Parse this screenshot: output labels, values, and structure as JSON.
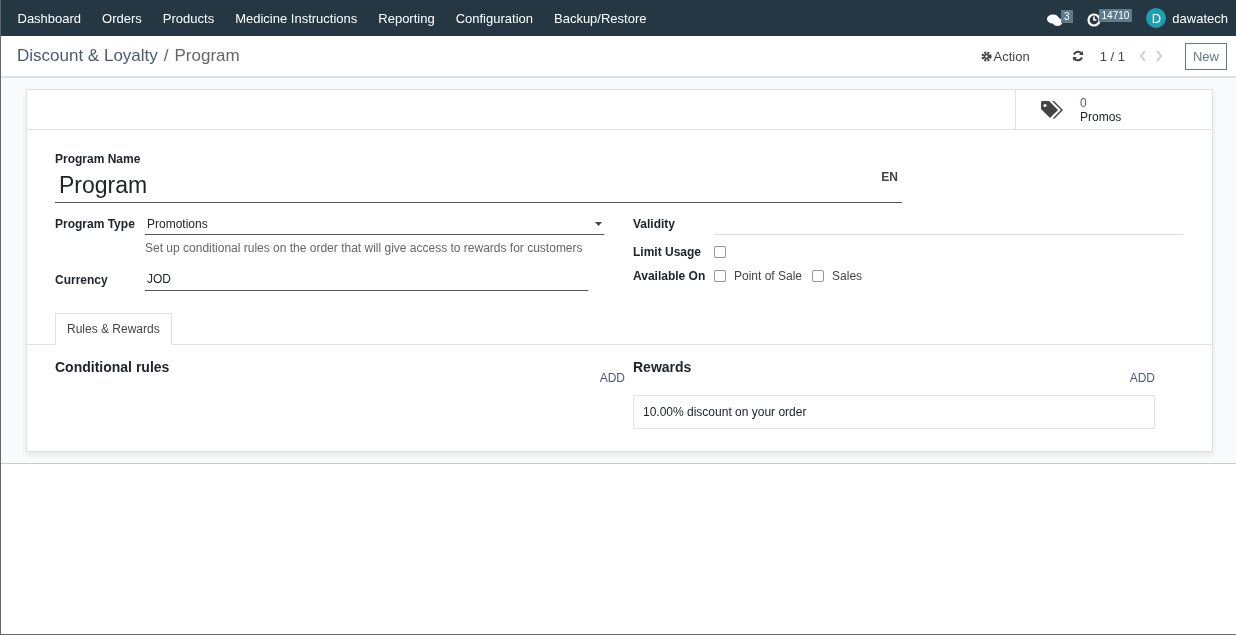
{
  "navbar": {
    "menu": [
      {
        "label": "Dashboard"
      },
      {
        "label": "Orders"
      },
      {
        "label": "Products"
      },
      {
        "label": "Medicine Instructions"
      },
      {
        "label": "Reporting"
      },
      {
        "label": "Configuration"
      },
      {
        "label": "Backup/Restore"
      }
    ],
    "messages_count": "3",
    "activities_count": "14710",
    "avatar_letter": "D",
    "user": "dawatech"
  },
  "control_panel": {
    "breadcrumb": [
      {
        "label": "Discount & Loyalty"
      },
      {
        "label": "Program"
      }
    ],
    "separator": "/",
    "action": "Action",
    "pager": "1 / 1",
    "new_button": "New"
  },
  "smart_button": {
    "value": "0",
    "label": "Promos"
  },
  "form": {
    "name_label": "Program Name",
    "name": "Program",
    "lang": "EN",
    "type_label": "Program Type",
    "type": "Promotions",
    "type_help": "Set up conditional rules on the order that will give access to rewards for customers",
    "currency_label": "Currency",
    "currency": "JOD",
    "validity_label": "Validity",
    "limit_label": "Limit Usage",
    "limit_checked": false,
    "available_label": "Available On",
    "available": [
      {
        "label": "Point of Sale",
        "checked": false
      },
      {
        "label": "Sales",
        "checked": false
      }
    ]
  },
  "tabs": [
    {
      "label": "Rules & Rewards",
      "selected": true
    }
  ],
  "rules": {
    "title": "Conditional rules",
    "add": "ADD"
  },
  "rewards": {
    "title": "Rewards",
    "add": "ADD",
    "items": [
      "10.00% discount on your order"
    ]
  }
}
